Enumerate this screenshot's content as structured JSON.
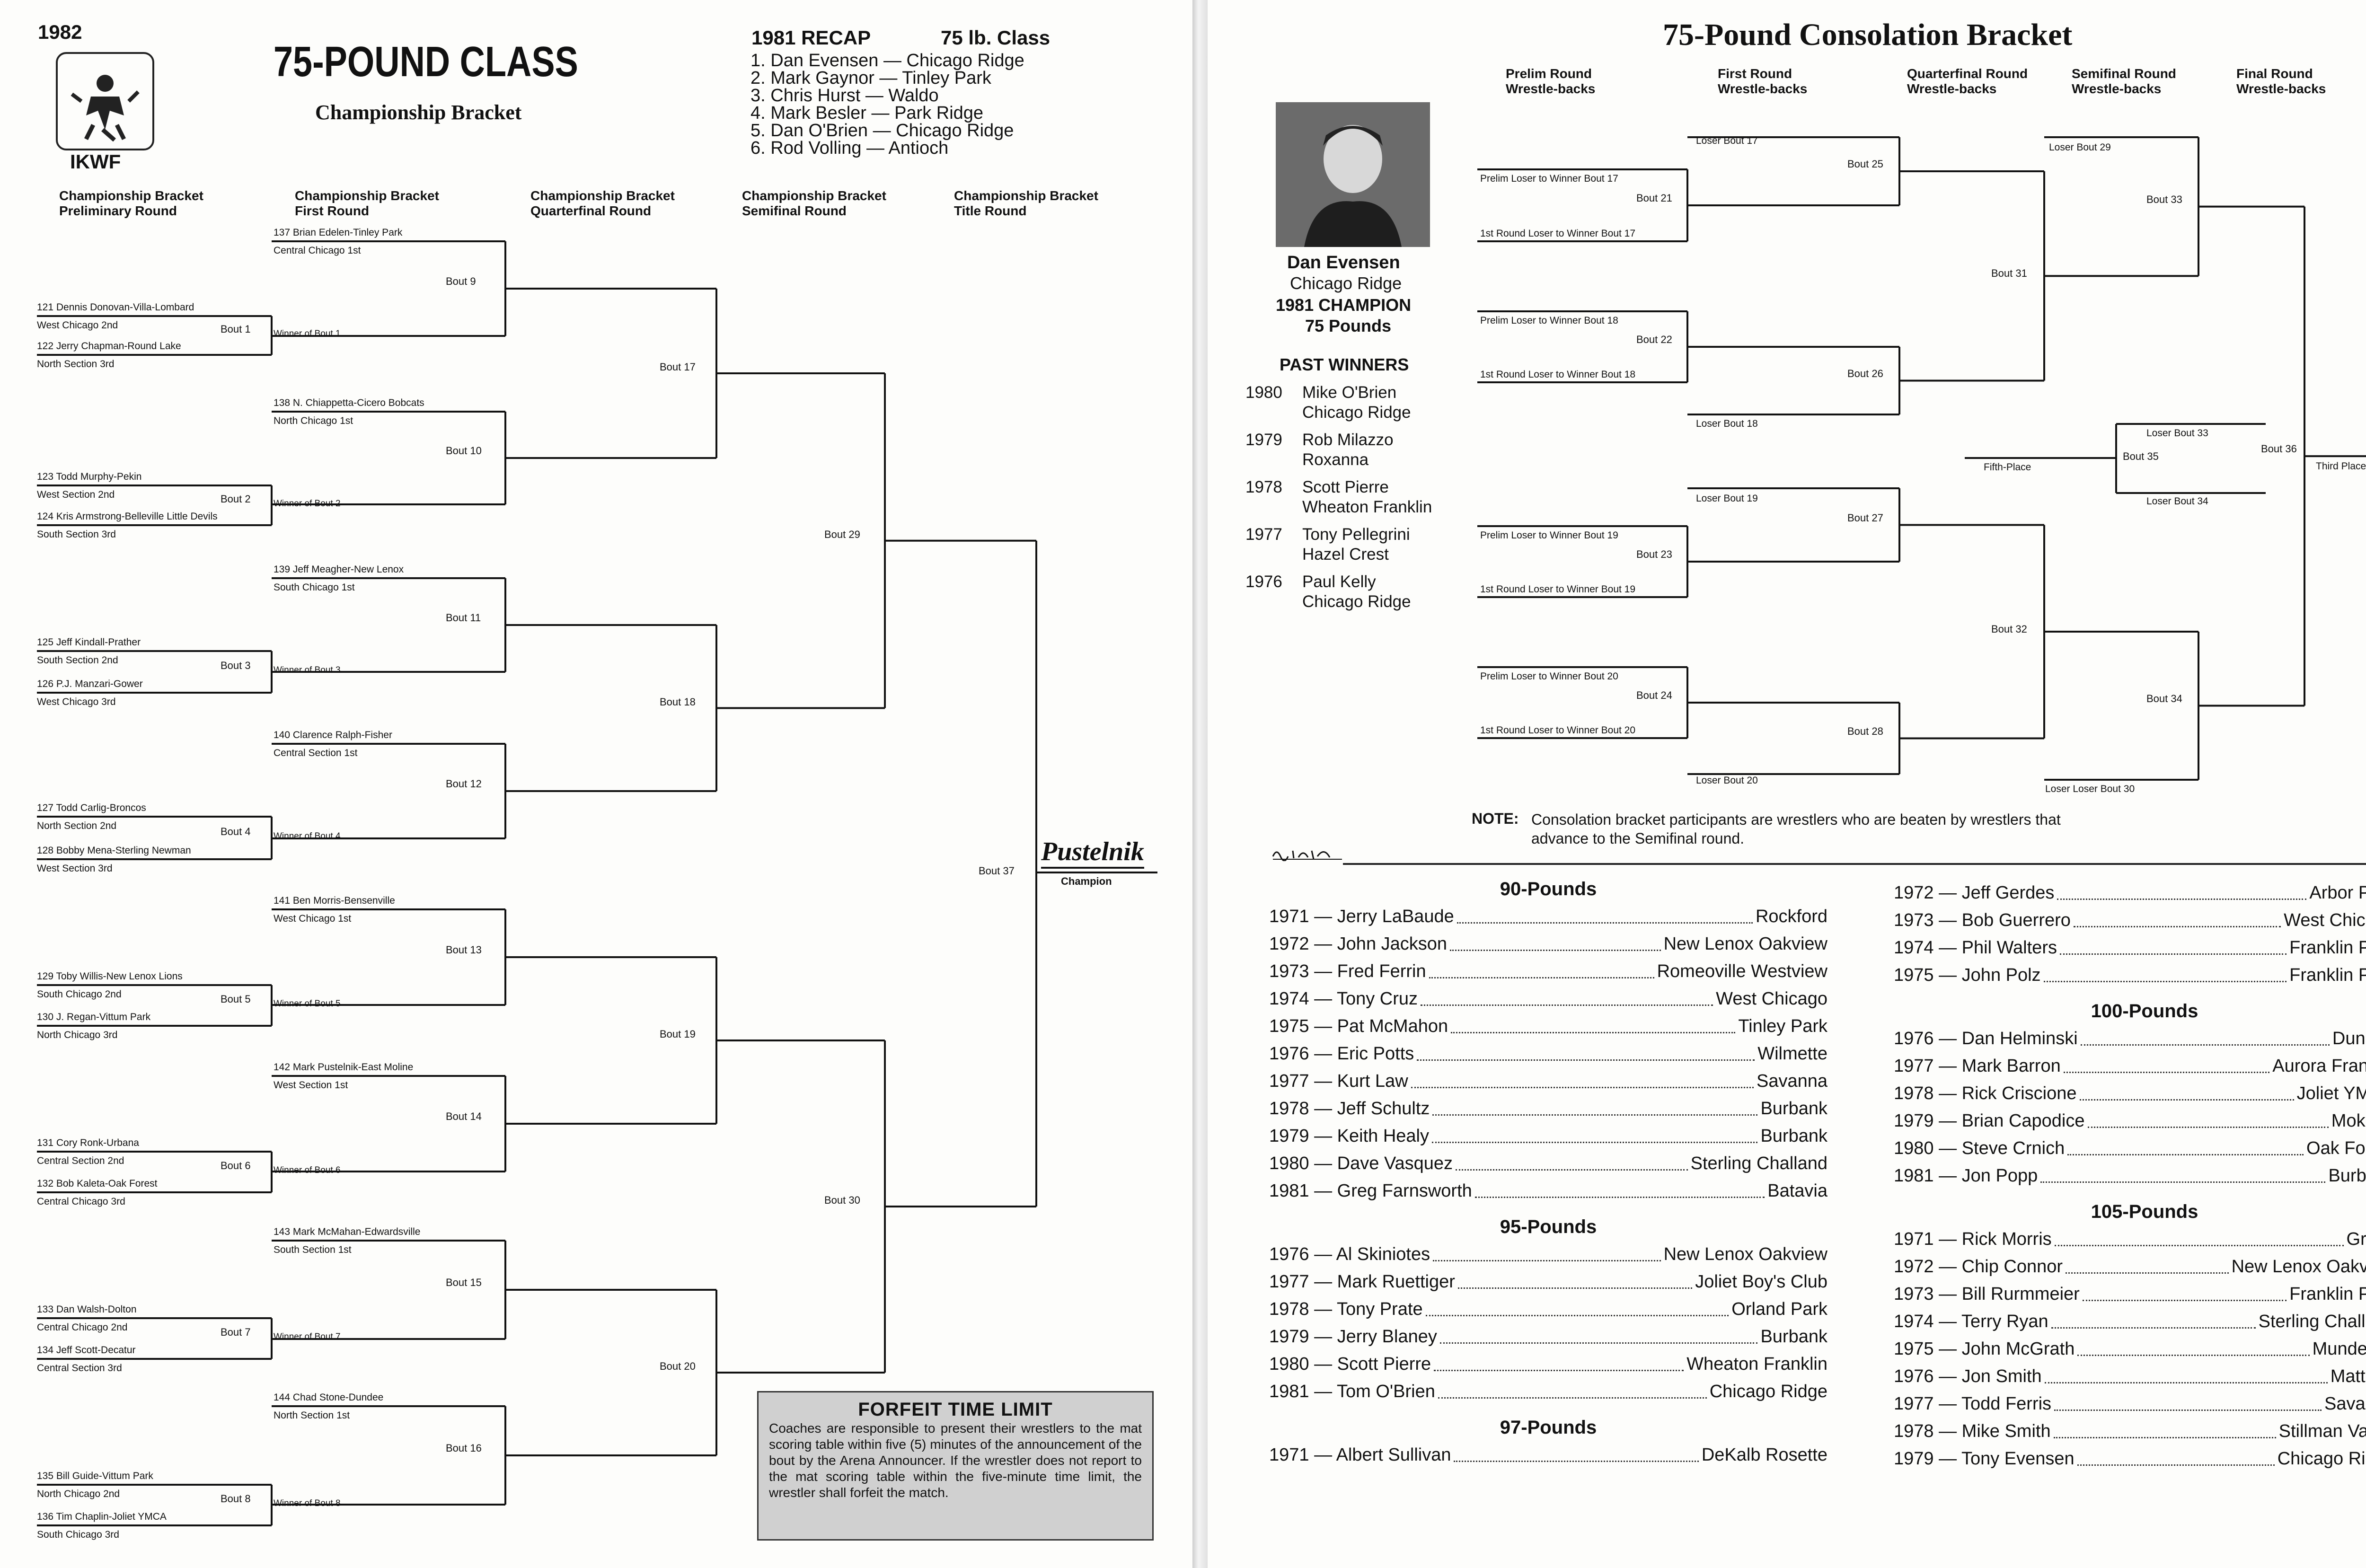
{
  "left": {
    "year": "1982",
    "org": "IKWF",
    "title": "75-POUND CLASS",
    "subtitle": "Championship Bracket",
    "recap_title": "1981 RECAP",
    "recap_class": "75 lb. Class",
    "recap": [
      "1. Dan Evensen — Chicago Ridge",
      "2. Mark Gaynor — Tinley Park",
      "3. Chris Hurst — Waldo",
      "4. Mark Besler — Park Ridge",
      "5. Dan O'Brien — Chicago Ridge",
      "6. Rod Volling — Antioch"
    ],
    "col_headers": [
      "Championship Bracket\nPreliminary Round",
      "Championship Bracket\nFirst Round",
      "Championship Bracket\nQuarterfinal Round",
      "Championship Bracket\nSemifinal Round",
      "Championship Bracket\nTitle Round"
    ],
    "prelim_entries": [
      {
        "name": "121 Dennis Donovan-Villa-Lombard",
        "qual": "West Chicago 2nd"
      },
      {
        "name": "122 Jerry Chapman-Round Lake",
        "qual": "North Section 3rd"
      },
      {
        "name": "123 Todd Murphy-Pekin",
        "qual": "West Section 2nd"
      },
      {
        "name": "124 Kris Armstrong-Belleville Little Devils",
        "qual": "South Section 3rd"
      },
      {
        "name": "125 Jeff Kindall-Prather",
        "qual": "South Section 2nd"
      },
      {
        "name": "126 P.J. Manzari-Gower",
        "qual": "West Chicago 3rd"
      },
      {
        "name": "127 Todd Carlig-Broncos",
        "qual": "North Section 2nd"
      },
      {
        "name": "128 Bobby Mena-Sterling Newman",
        "qual": "West Section 3rd"
      },
      {
        "name": "129 Toby Willis-New Lenox Lions",
        "qual": "South Chicago 2nd"
      },
      {
        "name": "130 J. Regan-Vittum Park",
        "qual": "North Chicago 3rd"
      },
      {
        "name": "131 Cory Ronk-Urbana",
        "qual": "Central Section 2nd"
      },
      {
        "name": "132 Bob Kaleta-Oak Forest",
        "qual": "Central Chicago 3rd"
      },
      {
        "name": "133 Dan Walsh-Dolton",
        "qual": "Central Chicago 2nd"
      },
      {
        "name": "134 Jeff Scott-Decatur",
        "qual": "Central Section 3rd"
      },
      {
        "name": "135 Bill Guide-Vittum Park",
        "qual": "North Chicago 2nd"
      },
      {
        "name": "136 Tim Chaplin-Joliet YMCA",
        "qual": "South Chicago 3rd"
      }
    ],
    "first_entries": [
      {
        "name": "137 Brian Edelen-Tinley Park",
        "qual": "Central Chicago 1st"
      },
      {
        "name": "138 N. Chiappetta-Cicero Bobcats",
        "qual": "North Chicago 1st"
      },
      {
        "name": "139 Jeff Meagher-New Lenox",
        "qual": "South Chicago 1st"
      },
      {
        "name": "140 Clarence Ralph-Fisher",
        "qual": "Central Section 1st"
      },
      {
        "name": "141 Ben Morris-Bensenville",
        "qual": "West Chicago 1st"
      },
      {
        "name": "142 Mark Pustelnik-East Moline",
        "qual": "West Section 1st"
      },
      {
        "name": "143 Mark McMahan-Edwardsville",
        "qual": "South Section 1st"
      },
      {
        "name": "144 Chad Stone-Dundee",
        "qual": "North Section 1st"
      }
    ],
    "winner_labels": [
      "Winner of Bout 1",
      "Winner of Bout 2",
      "Winner of Bout 3",
      "Winner of Bout 4",
      "Winner of Bout 5",
      "Winner of Bout 6",
      "Winner of Bout 7",
      "Winner of Bout 8"
    ],
    "prelim_bouts": [
      "Bout 1",
      "Bout 2",
      "Bout 3",
      "Bout 4",
      "Bout 5",
      "Bout 6",
      "Bout 7",
      "Bout 8"
    ],
    "first_bouts": [
      "Bout 9",
      "Bout 10",
      "Bout 11",
      "Bout 12",
      "Bout 13",
      "Bout 14",
      "Bout 15",
      "Bout 16"
    ],
    "quarter_bouts": [
      "Bout 17",
      "Bout 18",
      "Bout 19",
      "Bout 20"
    ],
    "semi_bouts": [
      "Bout 29",
      "Bout 30"
    ],
    "final_bout": "Bout 37",
    "champion_name": "Pustelnik",
    "champion_label": "Champion",
    "forfeit_title": "FORFEIT TIME LIMIT",
    "forfeit_text": "Coaches are responsible to present their wrestlers to the mat scoring table within five (5) minutes of the announcement of the bout by the Arena Announcer. If the wrestler does not report to the mat scoring table within the five-minute time limit, the wrestler shall forfeit the match."
  },
  "right": {
    "title": "75-Pound Consolation Bracket",
    "col_headers": [
      "Prelim Round\nWrestle-backs",
      "First Round\nWrestle-backs",
      "Quarterfinal Round\nWrestle-backs",
      "Semifinal Round\nWrestle-backs",
      "Final Round\nWrestle-backs"
    ],
    "champ_name": "Dan Evensen",
    "champ_town": "Chicago Ridge",
    "champ_title": "1981 CHAMPION",
    "champ_weight": "75 Pounds",
    "past_title": "PAST WINNERS",
    "past": [
      {
        "year": "1980",
        "name": "Mike O'Brien",
        "town": "Chicago Ridge"
      },
      {
        "year": "1979",
        "name": "Rob Milazzo",
        "town": "Roxanna"
      },
      {
        "year": "1978",
        "name": "Scott Pierre",
        "town": "Wheaton Franklin"
      },
      {
        "year": "1977",
        "name": "Tony Pellegrini",
        "town": "Hazel Crest"
      },
      {
        "year": "1976",
        "name": "Paul Kelly",
        "town": "Chicago Ridge"
      }
    ],
    "cons_prelim": [
      {
        "top": "Prelim Loser to Winner Bout 17",
        "bout": "Bout 21",
        "bot": "1st Round Loser to Winner Bout 17"
      },
      {
        "top": "Prelim Loser to Winner Bout 18",
        "bout": "Bout 22",
        "bot": "1st Round Loser to Winner Bout 18"
      },
      {
        "top": "Prelim Loser to Winner Bout 19",
        "bout": "Bout 23",
        "bot": "1st Round Loser to Winner Bout 19"
      },
      {
        "top": "Prelim Loser to Winner Bout 20",
        "bout": "Bout 24",
        "bot": "1st Round Loser to Winner Bout 20"
      }
    ],
    "cons_first": [
      {
        "loser": "Loser Bout 17",
        "bout": "Bout 25"
      },
      {
        "loser": "Loser Bout 18",
        "bout": "Bout 26"
      },
      {
        "loser": "Loser Bout 19",
        "bout": "Bout 27"
      },
      {
        "loser": "Loser Bout 20",
        "bout": "Bout 28"
      }
    ],
    "cons_quarter": [
      "Bout 31",
      "Bout 32"
    ],
    "loser_29": "Loser Bout 29",
    "loser_30": "Loser Loser Bout 30",
    "cons_semi": [
      "Bout 33",
      "Bout 34"
    ],
    "fifth_bout": "Bout 35",
    "loser_33": "Loser Bout 33",
    "loser_34": "Loser Bout 34",
    "fifth_label": "Fifth-Place",
    "third_bout": "Bout 36",
    "third_label": "Third Place",
    "note_label": "NOTE:",
    "note_text": "Consolation bracket participants are wrestlers who are beaten by wrestlers that advance to the Semifinal round.",
    "signature": "",
    "classes_left": [
      {
        "title": "90-Pounds",
        "rows": [
          {
            "y": "1971",
            "n": "Jerry LaBaude",
            "t": "Rockford"
          },
          {
            "y": "1972",
            "n": "John Jackson",
            "t": "New Lenox Oakview"
          },
          {
            "y": "1973",
            "n": "Fred Ferrin",
            "t": "Romeoville Westview"
          },
          {
            "y": "1974",
            "n": "Tony Cruz",
            "t": "West Chicago"
          },
          {
            "y": "1975",
            "n": "Pat McMahon",
            "t": "Tinley Park"
          },
          {
            "y": "1976",
            "n": "Eric Potts",
            "t": "Wilmette"
          },
          {
            "y": "1977",
            "n": "Kurt Law",
            "t": "Savanna"
          },
          {
            "y": "1978",
            "n": "Jeff Schultz",
            "t": "Burbank"
          },
          {
            "y": "1979",
            "n": "Keith Healy",
            "t": "Burbank"
          },
          {
            "y": "1980",
            "n": "Dave Vasquez",
            "t": "Sterling Challand"
          },
          {
            "y": "1981",
            "n": "Greg Farnsworth",
            "t": "Batavia"
          }
        ]
      },
      {
        "title": "95-Pounds",
        "rows": [
          {
            "y": "1976",
            "n": "Al Skiniotes",
            "t": "New Lenox Oakview"
          },
          {
            "y": "1977",
            "n": "Mark Ruettiger",
            "t": "Joliet Boy's Club"
          },
          {
            "y": "1978",
            "n": "Tony Prate",
            "t": "Orland Park"
          },
          {
            "y": "1979",
            "n": "Jerry Blaney",
            "t": "Burbank"
          },
          {
            "y": "1980",
            "n": "Scott Pierre",
            "t": "Wheaton Franklin"
          },
          {
            "y": "1981",
            "n": "Tom O'Brien",
            "t": "Chicago Ridge"
          }
        ]
      },
      {
        "title": "97-Pounds",
        "rows": [
          {
            "y": "1971",
            "n": "Albert Sullivan",
            "t": "DeKalb Rosette"
          }
        ]
      }
    ],
    "classes_right_top": [
      {
        "y": "1972",
        "n": "Jeff Gerdes",
        "t": "Arbor Park"
      },
      {
        "y": "1973",
        "n": "Bob Guerrero",
        "t": "West Chicago"
      },
      {
        "y": "1974",
        "n": "Phil Walters",
        "t": "Franklin Park"
      },
      {
        "y": "1975",
        "n": "John Polz",
        "t": "Franklin Park"
      }
    ],
    "classes_right": [
      {
        "title": "100-Pounds",
        "rows": [
          {
            "y": "1976",
            "n": "Dan Helminski",
            "t": "Dundee"
          },
          {
            "y": "1977",
            "n": "Mark Barron",
            "t": "Aurora Franklin"
          },
          {
            "y": "1978",
            "n": "Rick Criscione",
            "t": "Joliet YMCA"
          },
          {
            "y": "1979",
            "n": "Brian Capodice",
            "t": "Mokena"
          },
          {
            "y": "1980",
            "n": "Steve Crnich",
            "t": "Oak Forest"
          },
          {
            "y": "1981",
            "n": "Jon Popp",
            "t": "Burbank"
          }
        ]
      },
      {
        "title": "105-Pounds",
        "rows": [
          {
            "y": "1971",
            "n": "Rick Morris",
            "t": "Grove"
          },
          {
            "y": "1972",
            "n": "Chip Connor",
            "t": "New Lenox Oakview"
          },
          {
            "y": "1973",
            "n": "Bill Rurmmeier",
            "t": "Franklin Park"
          },
          {
            "y": "1974",
            "n": "Terry Ryan",
            "t": "Sterling Challand"
          },
          {
            "y": "1975",
            "n": "John McGrath",
            "t": "Mundelein"
          },
          {
            "y": "1976",
            "n": "Jon Smith",
            "t": "Mattoon"
          },
          {
            "y": "1977",
            "n": "Todd Ferris",
            "t": "Savanna"
          },
          {
            "y": "1978",
            "n": "Mike Smith",
            "t": "Stillman Valley"
          },
          {
            "y": "1979",
            "n": "Tony Evensen",
            "t": "Chicago Ridge"
          }
        ]
      }
    ]
  }
}
